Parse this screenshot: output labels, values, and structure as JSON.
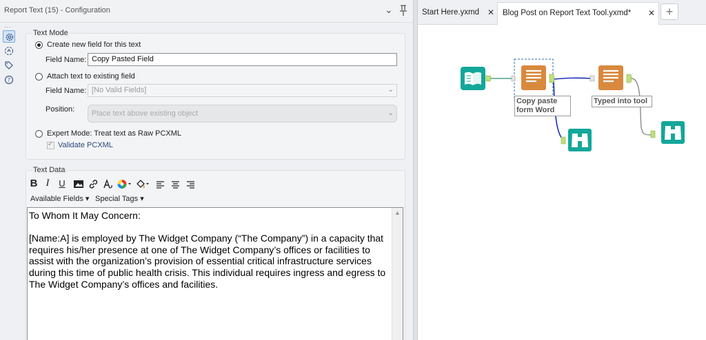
{
  "config": {
    "title": "Report Text (15) - Configuration",
    "dots": "...",
    "text_mode": {
      "label": "Text Mode",
      "create_new_label": "Create new field for this text",
      "field_name_label": "Field Name:",
      "field_name_value": "Copy Pasted Field",
      "attach_label": "Attach text to existing field",
      "attach_field_name_label": "Field Name:",
      "attach_field_value": "[No Valid Fields]",
      "position_label": "Position:",
      "position_value": "Place text above existing object",
      "expert_label": "Expert Mode: Treat text as Raw PCXML",
      "validate_label": "Validate PCXML"
    },
    "text_data": {
      "label": "Text Data",
      "available_fields": "Available Fields ▾",
      "special_tags": "Special Tags ▾",
      "toolbar": {
        "bold": "B",
        "italic": "I",
        "underline": "U"
      },
      "paragraphs": [
        "To Whom It May Concern:",
        "[Name:A] is employed by The Widget Company (“The Company”) in a capacity that requires his/her presence at one of The Widget Company’s offices or facilities to assist with the organization’s provision of essential critical infrastructure services during this time of public health crisis.  This individual requires ingress and egress to The Widget Company’s offices and facilities."
      ]
    }
  },
  "tabs": [
    {
      "label": "Start Here.yxmd",
      "close": "✕"
    },
    {
      "label": "Blog Post on Report Text Tool.yxmd*",
      "close": "✕",
      "active": true
    }
  ],
  "tab_add": "+",
  "workflow": {
    "tool_caption_1": "Copy paste form Word",
    "tool_caption_2": "Typed into tool",
    "colors": {
      "teal": "#13a79a",
      "orange": "#d9893e",
      "connector_blue": "#1f2fb8"
    }
  }
}
